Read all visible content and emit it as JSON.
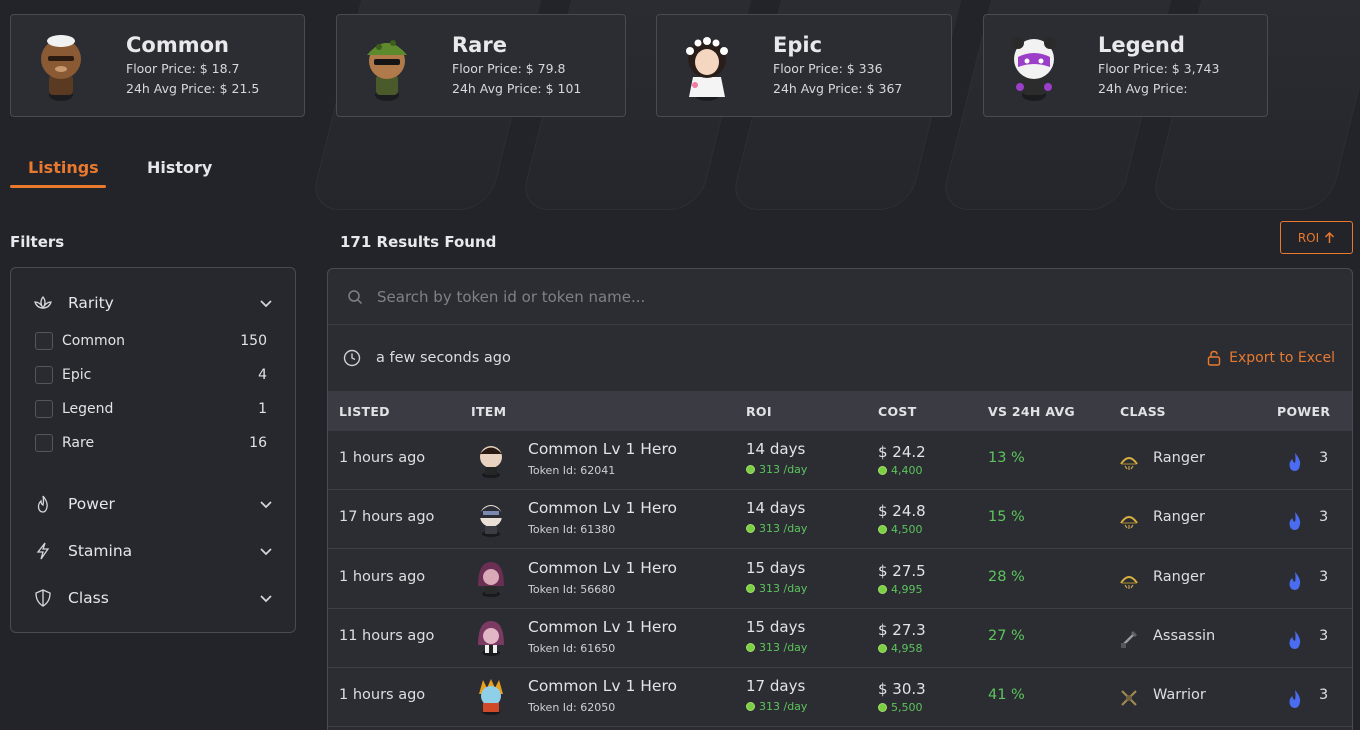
{
  "colors": {
    "accent": "#e8792f",
    "positive": "#5cc45c",
    "power": "#4a6cf0"
  },
  "cards": [
    {
      "title": "Common",
      "floor": "Floor Price: $ 18.7",
      "avg": "24h Avg Price: $ 21.5",
      "icon": "common-hero-avatar"
    },
    {
      "title": "Rare",
      "floor": "Floor Price: $ 79.8",
      "avg": "24h Avg Price: $ 101",
      "icon": "rare-hero-avatar"
    },
    {
      "title": "Epic",
      "floor": "Floor Price: $ 336",
      "avg": "24h Avg Price: $ 367",
      "icon": "epic-hero-avatar"
    },
    {
      "title": "Legend",
      "floor": "Floor Price: $ 3,743",
      "avg": "24h Avg Price:",
      "icon": "legend-hero-avatar"
    }
  ],
  "tabs": [
    {
      "label": "Listings",
      "active": true
    },
    {
      "label": "History",
      "active": false
    }
  ],
  "filters": {
    "title": "Filters",
    "rarity": {
      "label": "Rarity",
      "options": [
        {
          "label": "Common",
          "count": "150"
        },
        {
          "label": "Epic",
          "count": "4"
        },
        {
          "label": "Legend",
          "count": "1"
        },
        {
          "label": "Rare",
          "count": "16"
        }
      ]
    },
    "power": "Power",
    "stamina": "Stamina",
    "class": "Class"
  },
  "results": {
    "title": "171 Results Found",
    "sort_label": "ROI"
  },
  "search": {
    "placeholder": "Search by token id or token name..."
  },
  "updated": "a few seconds ago",
  "export_label": "Export to Excel",
  "columns": [
    "LISTED",
    "ITEM",
    "ROI",
    "COST",
    "VS 24H AVG",
    "CLASS",
    "POWER"
  ],
  "rows": [
    {
      "listed": "1 hours ago",
      "name": "Common Lv 1 Hero",
      "token": "Token Id: 62041",
      "roi": "14 days",
      "rate": "313 /day",
      "cost": "$ 24.2",
      "cost_sub": "4,400",
      "vs": "13 %",
      "class": "Ranger",
      "class_icon": "ranger-class-icon",
      "power": "3"
    },
    {
      "listed": "17 hours ago",
      "name": "Common Lv 1 Hero",
      "token": "Token Id: 61380",
      "roi": "14 days",
      "rate": "313 /day",
      "cost": "$ 24.8",
      "cost_sub": "4,500",
      "vs": "15 %",
      "class": "Ranger",
      "class_icon": "ranger-class-icon",
      "power": "3"
    },
    {
      "listed": "1 hours ago",
      "name": "Common Lv 1 Hero",
      "token": "Token Id: 56680",
      "roi": "15 days",
      "rate": "313 /day",
      "cost": "$ 27.5",
      "cost_sub": "4,995",
      "vs": "28 %",
      "class": "Ranger",
      "class_icon": "ranger-class-icon",
      "power": "3"
    },
    {
      "listed": "11 hours ago",
      "name": "Common Lv 1 Hero",
      "token": "Token Id: 61650",
      "roi": "15 days",
      "rate": "313 /day",
      "cost": "$ 27.3",
      "cost_sub": "4,958",
      "vs": "27 %",
      "class": "Assassin",
      "class_icon": "assassin-class-icon",
      "power": "3"
    },
    {
      "listed": "1 hours ago",
      "name": "Common Lv 1 Hero",
      "token": "Token Id: 62050",
      "roi": "17 days",
      "rate": "313 /day",
      "cost": "$ 30.3",
      "cost_sub": "5,500",
      "vs": "41 %",
      "class": "Warrior",
      "class_icon": "warrior-class-icon",
      "power": "3"
    }
  ]
}
